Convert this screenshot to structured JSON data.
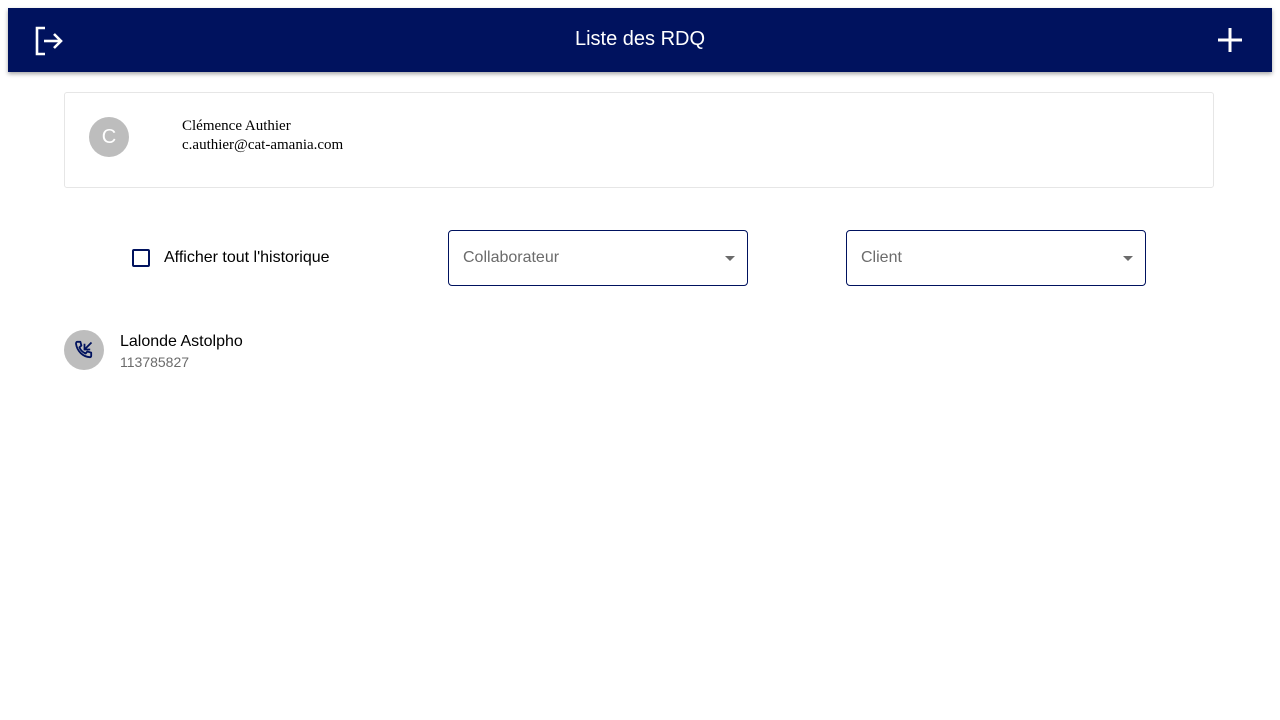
{
  "header": {
    "title": "Liste des RDQ",
    "logout_icon": "logout-icon",
    "add_icon": "plus-icon",
    "color": "#00125e"
  },
  "user": {
    "initial": "C",
    "name": "Clémence Authier",
    "email": "c.authier@cat-amania.com"
  },
  "filters": {
    "history_label": "Afficher tout l'historique",
    "history_checked": false,
    "collaborateur_placeholder": "Collaborateur",
    "client_placeholder": "Client"
  },
  "rdq_list": [
    {
      "icon": "phone-callback-icon",
      "name": "Lalonde Astolpho",
      "number": "113785827"
    }
  ]
}
